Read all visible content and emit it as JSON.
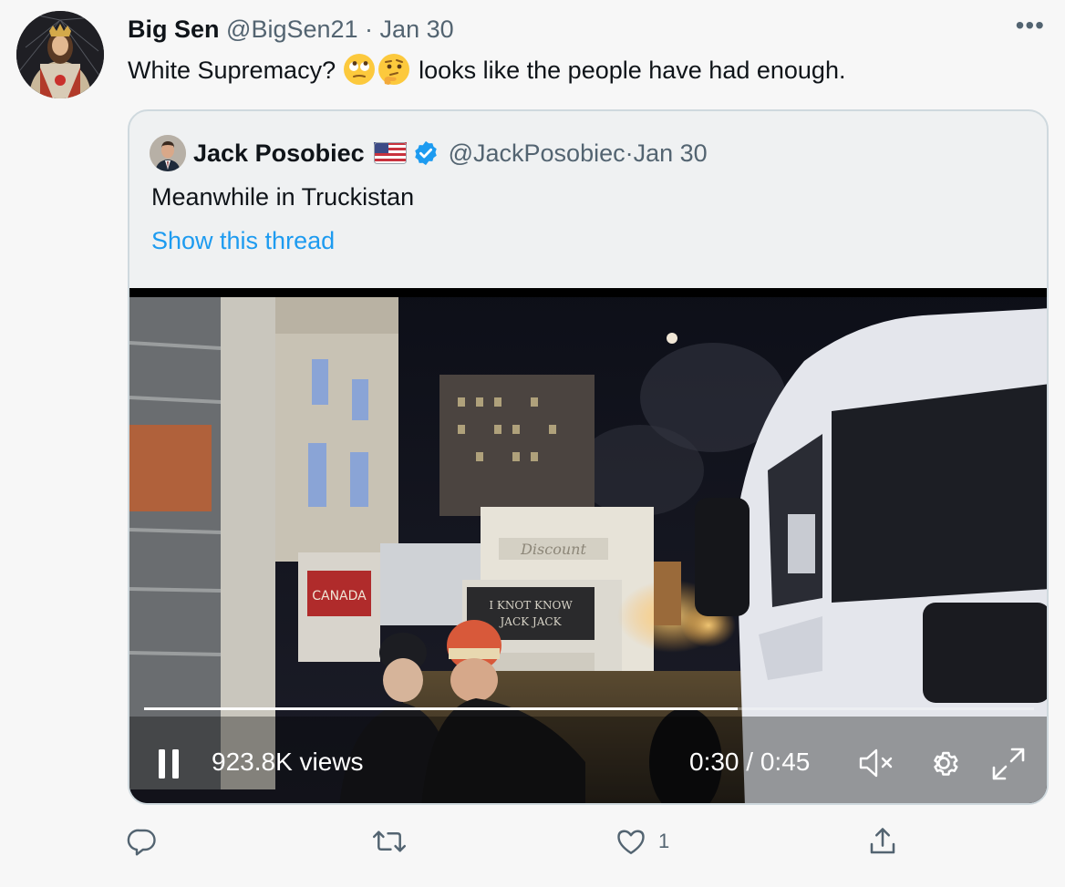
{
  "tweet": {
    "author_name": "Big Sen",
    "handle": "@BigSen21",
    "separator": " · ",
    "date": "Jan 30",
    "text_before": "White Supremacy? ",
    "emojis": [
      "face-with-rolling-eyes-emoji",
      "thinking-face-emoji"
    ],
    "text_after": " looks like the people have had enough.",
    "more_icon": "more-horizontal-icon",
    "more_label": "•••"
  },
  "quote": {
    "author_name": "Jack Posobiec",
    "flag": "us-flag-icon",
    "verified": "verified-badge-icon",
    "handle": "@JackPosobiec",
    "separator": " · ",
    "date": "Jan 30",
    "text": "Meanwhile in Truckistan",
    "thread_link": "Show this thread",
    "video": {
      "views": "923.8K views",
      "current_time": "0:30",
      "time_separator": " / ",
      "duration": "0:45",
      "progress": 0.667,
      "truck_sign": "Discount",
      "truck_windshield_line1": "I KNOT KNOW",
      "truck_windshield_line2": "JACK JACK",
      "banner_text": "CANADA"
    }
  },
  "actions": {
    "reply_icon": "reply-icon",
    "retweet_icon": "retweet-icon",
    "like_icon": "heart-icon",
    "like_count": "1",
    "share_icon": "share-icon"
  },
  "colors": {
    "background": "#f7f7f7",
    "quote_background": "#eff1f2",
    "link": "#1d9bf0",
    "verified": "#1d9bf0",
    "muted": "#536471",
    "text": "#0f1419"
  }
}
